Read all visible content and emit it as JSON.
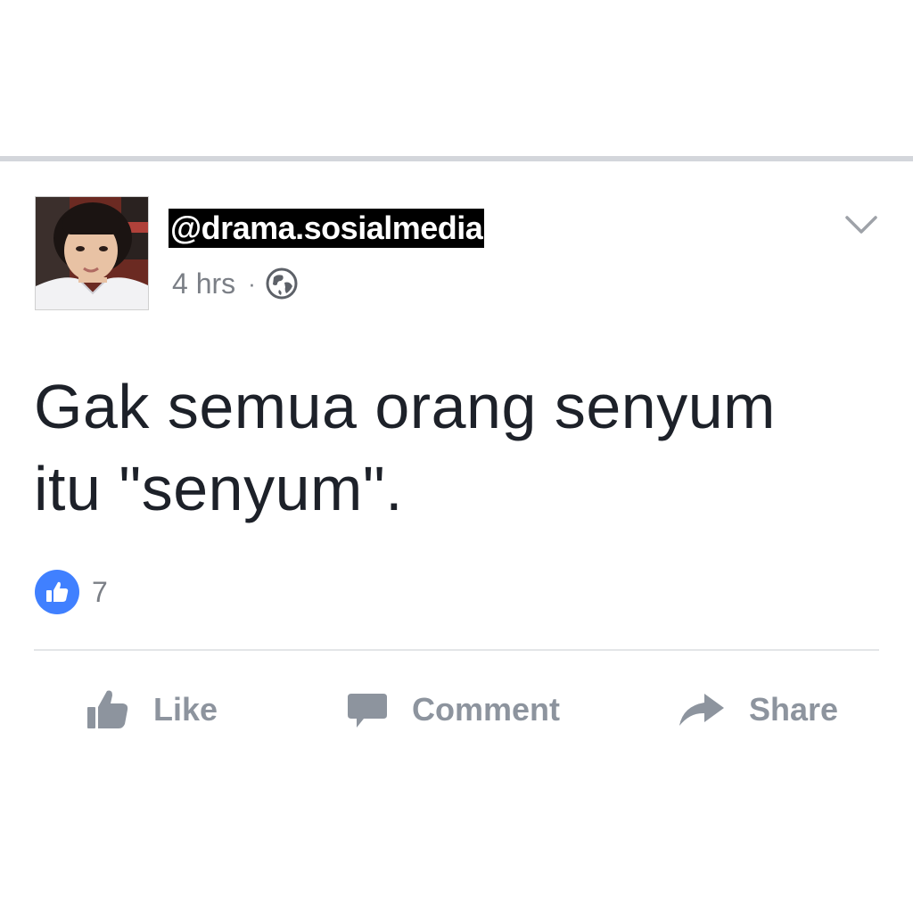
{
  "post": {
    "username": "@drama.sosialmedia",
    "time": "4 hrs",
    "separator": "·",
    "privacy_icon": "globe-icon",
    "text_line1": "Gak semua orang senyum",
    "text_line2": "itu \"senyum\".",
    "reaction_count": "7"
  },
  "actions": {
    "like_label": "Like",
    "comment_label": "Comment",
    "share_label": "Share"
  },
  "colors": {
    "like_blue": "#4080ff",
    "action_gray": "#8d949e",
    "text_dark": "#1d2129",
    "meta_gray": "#7b7f86"
  }
}
